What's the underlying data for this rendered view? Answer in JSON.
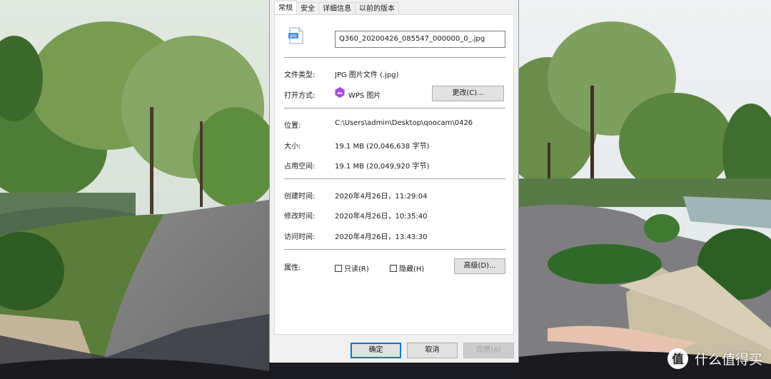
{
  "tabs": [
    "常规",
    "安全",
    "详细信息",
    "以前的版本"
  ],
  "file_name": "Q360_20200426_085547_000000_0_.jpg",
  "rows": {
    "type_label": "文件类型:",
    "type_value": "JPG 图片文件 (.jpg)",
    "open_label": "打开方式:",
    "open_value": "WPS 图片",
    "change_button": "更改(C)...",
    "location_label": "位置:",
    "location_value": "C:\\Users\\admin\\Desktop\\qoocam\\0426",
    "size_label": "大小:",
    "size_value": "19.1 MB (20,046,638 字节)",
    "disk_label": "占用空间:",
    "disk_value": "19.1 MB (20,049,920 字节)",
    "created_label": "创建时间:",
    "created_value": "2020年4月26日，11:29:04",
    "modified_label": "修改时间:",
    "modified_value": "2020年4月26日，10:35:40",
    "accessed_label": "访问时间:",
    "accessed_value": "2020年4月26日，13:43:30",
    "attr_label": "属性:",
    "readonly_label": "只读(R)",
    "hidden_label": "隐藏(H)",
    "advanced_button": "高级(D)..."
  },
  "buttons": {
    "ok": "确定",
    "cancel": "取消",
    "apply": "应用(A)"
  },
  "icons": {
    "file": "jpg-file-icon",
    "wps": "wps-picture-icon",
    "watermark": "smzdm-logo-icon"
  },
  "watermark": {
    "text": "什么值得买"
  },
  "colors": {
    "focus": "#0078d7",
    "wps": "#a34cf0"
  }
}
